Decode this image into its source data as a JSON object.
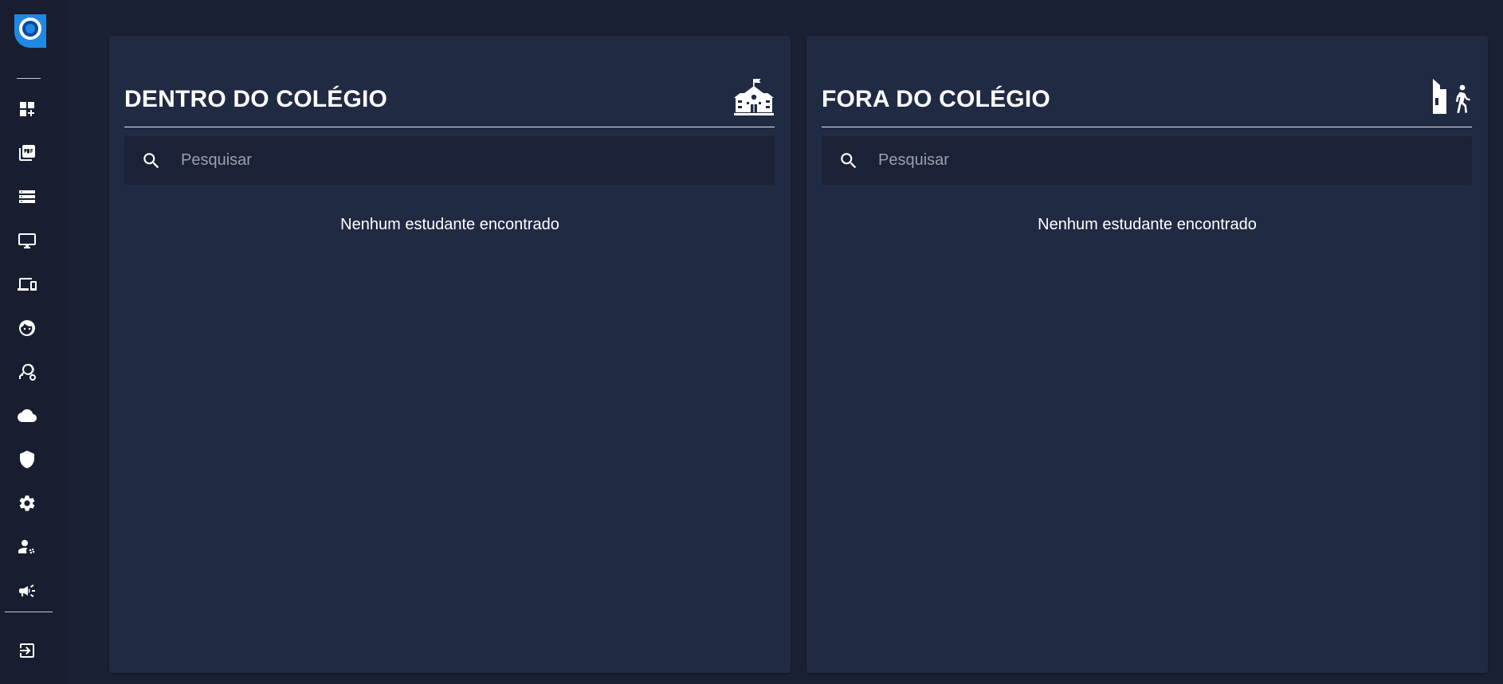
{
  "sidebar": {
    "logo_icon": "app-logo-icon",
    "accent_color": "#1e88e5",
    "items": [
      {
        "icon": "dashboard-add-icon"
      },
      {
        "icon": "pdf-icon"
      },
      {
        "icon": "list-storage-icon"
      },
      {
        "icon": "monitor-icon"
      },
      {
        "icon": "devices-icon"
      },
      {
        "icon": "child-face-icon"
      },
      {
        "icon": "key-search-icon"
      },
      {
        "icon": "cloud-icon"
      },
      {
        "icon": "shield-icon"
      },
      {
        "icon": "gear-icon"
      },
      {
        "icon": "user-settings-icon"
      },
      {
        "icon": "megaphone-icon"
      },
      {
        "icon": "logout-icon"
      }
    ]
  },
  "panels": {
    "inside": {
      "title": "DENTRO DO COLÉGIO",
      "icon": "school-icon",
      "search_placeholder": "Pesquisar",
      "search_value": "",
      "empty_message": "Nenhum estudante encontrado"
    },
    "outside": {
      "title": "FORA DO COLÉGIO",
      "icon": "leaving-building-icon",
      "search_placeholder": "Pesquisar",
      "search_value": "",
      "empty_message": "Nenhum estudante encontrado"
    }
  }
}
